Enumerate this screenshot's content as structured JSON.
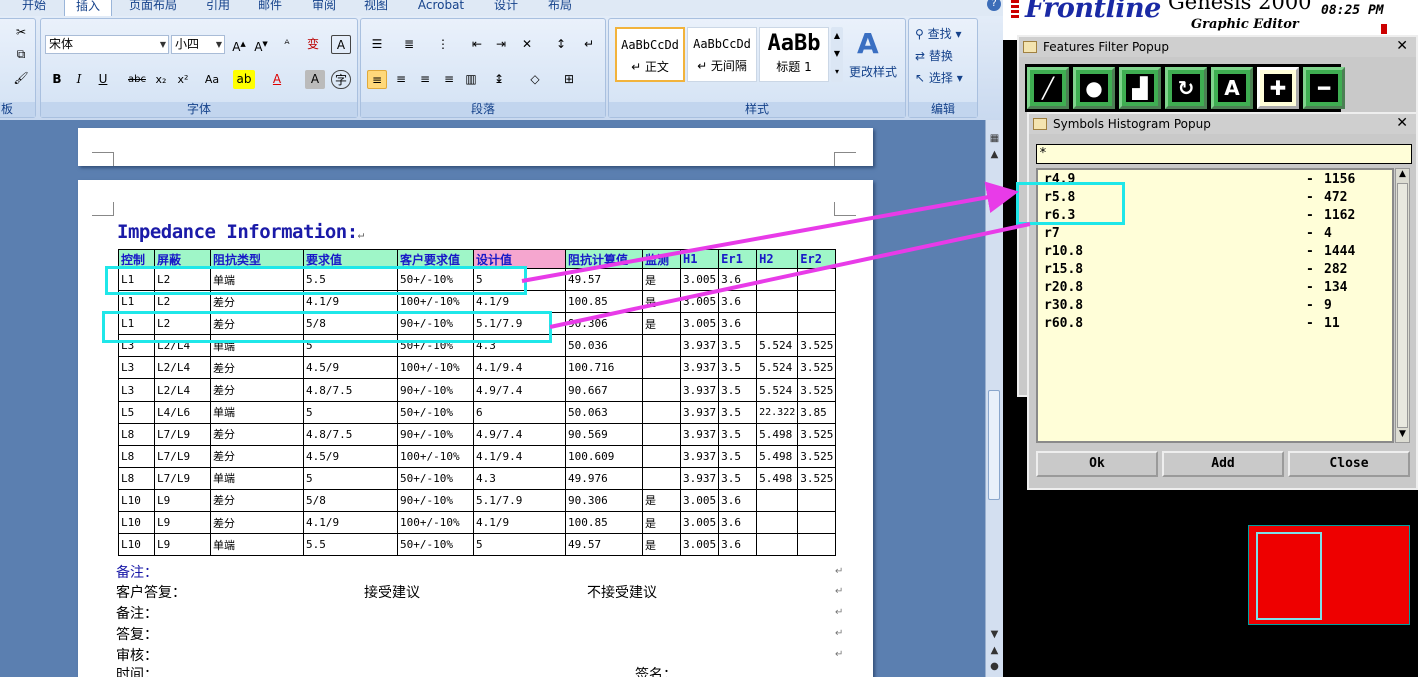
{
  "word": {
    "tabs": [
      "开始",
      "插入",
      "页面布局",
      "引用",
      "邮件",
      "审阅",
      "视图",
      "Acrobat",
      "设计",
      "布局"
    ],
    "active_tab": "插入",
    "help": "?",
    "font_name": "宋体",
    "font_size": "小四",
    "groups": {
      "font": "字体",
      "paragraph": "段落",
      "styles": "样式",
      "edit": "编辑",
      "board": "板"
    },
    "styles": [
      {
        "preview": "AaBbCcDd",
        "name": "↵ 正文"
      },
      {
        "preview": "AaBbCcDd",
        "name": "↵ 无间隔"
      },
      {
        "preview": "AaBb",
        "name": "标题 1"
      }
    ],
    "change_styles": "更改样式",
    "edit": {
      "find": "查找",
      "replace": "替换",
      "select": "选择"
    },
    "doc_title": "Impedance Information:",
    "table": {
      "headers": [
        "控制",
        "屏蔽",
        "阻抗类型",
        "要求值",
        "客户要求值",
        "设计值",
        "阻抗计算值",
        "监测",
        "H1",
        "Er1",
        "H2",
        "Er2"
      ],
      "rows": [
        [
          "L1",
          "L2",
          "单端",
          "5.5",
          "50+/-10%",
          "5",
          "49.57",
          "是",
          "3.005",
          "3.6",
          "",
          ""
        ],
        [
          "L1",
          "L2",
          "差分",
          "4.1/9",
          "100+/-10%",
          "4.1/9",
          "100.85",
          "是",
          "3.005",
          "3.6",
          "",
          ""
        ],
        [
          "L1",
          "L2",
          "差分",
          "5/8",
          "90+/-10%",
          "5.1/7.9",
          "90.306",
          "是",
          "3.005",
          "3.6",
          "",
          ""
        ],
        [
          "L3",
          "L2/L4",
          "单端",
          "5",
          "50+/-10%",
          "4.3",
          "50.036",
          "",
          "3.937",
          "3.5",
          "5.524",
          "3.525"
        ],
        [
          "L3",
          "L2/L4",
          "差分",
          "4.5/9",
          "100+/-10%",
          "4.1/9.4",
          "100.716",
          "",
          "3.937",
          "3.5",
          "5.524",
          "3.525"
        ],
        [
          "L3",
          "L2/L4",
          "差分",
          "4.8/7.5",
          "90+/-10%",
          "4.9/7.4",
          "90.667",
          "",
          "3.937",
          "3.5",
          "5.524",
          "3.525"
        ],
        [
          "L5",
          "L4/L6",
          "单端",
          "5",
          "50+/-10%",
          "6",
          "50.063",
          "",
          "3.937",
          "3.5",
          "22.322",
          "3.85"
        ],
        [
          "L8",
          "L7/L9",
          "差分",
          "4.8/7.5",
          "90+/-10%",
          "4.9/7.4",
          "90.569",
          "",
          "3.937",
          "3.5",
          "5.498",
          "3.525"
        ],
        [
          "L8",
          "L7/L9",
          "差分",
          "4.5/9",
          "100+/-10%",
          "4.1/9.4",
          "100.609",
          "",
          "3.937",
          "3.5",
          "5.498",
          "3.525"
        ],
        [
          "L8",
          "L7/L9",
          "单端",
          "5",
          "50+/-10%",
          "4.3",
          "49.976",
          "",
          "3.937",
          "3.5",
          "5.498",
          "3.525"
        ],
        [
          "L10",
          "L9",
          "差分",
          "5/8",
          "90+/-10%",
          "5.1/7.9",
          "90.306",
          "是",
          "3.005",
          "3.6",
          "",
          ""
        ],
        [
          "L10",
          "L9",
          "差分",
          "4.1/9",
          "100+/-10%",
          "4.1/9",
          "100.85",
          "是",
          "3.005",
          "3.6",
          "",
          ""
        ],
        [
          "L10",
          "L9",
          "单端",
          "5.5",
          "50+/-10%",
          "5",
          "49.57",
          "是",
          "3.005",
          "3.6",
          "",
          ""
        ]
      ]
    },
    "notes": {
      "remark": "备注：",
      "reply": "客户答复：",
      "accept": "接受建议",
      "reject": "不接受建议",
      "remark2": "备注：",
      "answer": "答复：",
      "review": "审核：",
      "time": "时间：",
      "sign": "签名："
    }
  },
  "genesis": {
    "logo": "Frontline",
    "app_name": "Genesis 2000",
    "subtitle": "Graphic Editor",
    "time": "08:25 PM",
    "features_popup_title": "Features Filter Popup",
    "histogram_popup_title": "Symbols Histogram Popup",
    "filter_value": "*",
    "symbols": [
      {
        "name": "r4.9",
        "count": "1156"
      },
      {
        "name": "r5.8",
        "count": "472"
      },
      {
        "name": "r6.3",
        "count": "1162"
      },
      {
        "name": "r7",
        "count": "4"
      },
      {
        "name": "r10.8",
        "count": "1444"
      },
      {
        "name": "r15.8",
        "count": "282"
      },
      {
        "name": "r20.8",
        "count": "134"
      },
      {
        "name": "r30.8",
        "count": "9"
      },
      {
        "name": "r60.8",
        "count": "11"
      }
    ],
    "buttons": {
      "ok": "Ok",
      "add": "Add",
      "close": "Close"
    }
  },
  "colors": {
    "highlight": "#1fe7e9",
    "arrow": "#e83be8",
    "header_green": "#9ff6c8",
    "header_pink": "#f5a6cf"
  }
}
